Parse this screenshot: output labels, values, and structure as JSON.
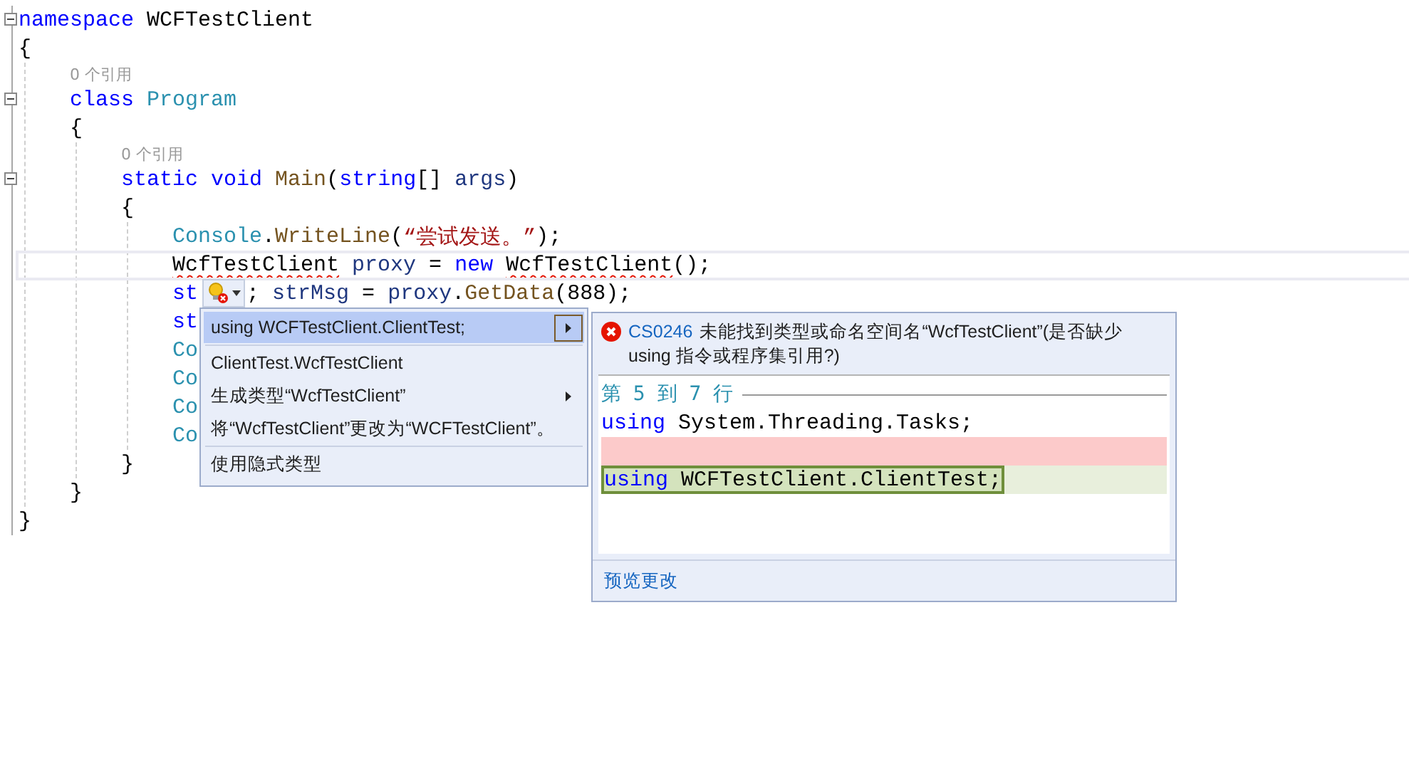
{
  "editor": {
    "blocks": [
      {
        "kind": "block",
        "expanded": true,
        "open": "{",
        "close": "}",
        "tokens": [
          {
            "text": "namespace",
            "kind": "keyword"
          },
          {
            "text": "WCFTestClient",
            "kind": "plain",
            "space_before": true
          }
        ],
        "children": [
          {
            "kind": "lens",
            "text": "0 个引用"
          },
          {
            "kind": "block",
            "expanded": true,
            "open": "{",
            "close": "}",
            "tokens": [
              {
                "text": "class",
                "kind": "keyword"
              },
              {
                "text": "Program",
                "kind": "type",
                "space_before": true
              }
            ],
            "children": [
              {
                "kind": "lens",
                "text": "0 个引用"
              },
              {
                "kind": "block",
                "expanded": true,
                "open": "{",
                "close": "}",
                "tokens": [
                  {
                    "text": "static",
                    "kind": "keyword"
                  },
                  {
                    "text": "void",
                    "kind": "keyword",
                    "space_before": true
                  },
                  {
                    "text": "Main",
                    "kind": "method",
                    "space_before": true
                  },
                  {
                    "text": "(",
                    "kind": "plain"
                  },
                  {
                    "text": "string",
                    "kind": "keyword"
                  },
                  {
                    "text": "[]",
                    "kind": "plain"
                  },
                  {
                    "text": "args",
                    "kind": "variable",
                    "space_before": true
                  },
                  {
                    "text": ")",
                    "kind": "plain"
                  }
                ],
                "children": [
                  {
                    "kind": "line",
                    "current": false,
                    "tokens": [
                      {
                        "text": "Console",
                        "kind": "type"
                      },
                      {
                        "text": ".",
                        "kind": "plain"
                      },
                      {
                        "text": "WriteLine",
                        "kind": "method"
                      },
                      {
                        "text": "(",
                        "kind": "plain"
                      },
                      {
                        "text": "“尝试发送。”",
                        "kind": "string"
                      },
                      {
                        "text": ");",
                        "kind": "plain"
                      }
                    ]
                  },
                  {
                    "kind": "line",
                    "current": true,
                    "tokens": [
                      {
                        "text": "WcfTestClient",
                        "kind": "error"
                      },
                      {
                        "text": "proxy",
                        "kind": "variable",
                        "space_before": true
                      },
                      {
                        "text": "=",
                        "kind": "plain",
                        "space_before": true
                      },
                      {
                        "text": "new",
                        "kind": "keyword",
                        "space_before": true
                      },
                      {
                        "text": "WcfTestClient",
                        "kind": "error",
                        "space_before": true
                      },
                      {
                        "text": "();",
                        "kind": "plain"
                      }
                    ]
                  },
                  {
                    "kind": "line",
                    "current": false,
                    "tokens": [
                      {
                        "text": "st",
                        "kind": "keyword"
                      },
                      {
                        "kind": "bulb"
                      },
                      {
                        "text": ";",
                        "kind": "plain"
                      },
                      {
                        "text": "strMsg",
                        "kind": "variable",
                        "space_before": true
                      },
                      {
                        "text": "=",
                        "kind": "plain",
                        "space_before": true
                      },
                      {
                        "text": "proxy",
                        "kind": "variable",
                        "space_before": true
                      },
                      {
                        "text": ".",
                        "kind": "plain"
                      },
                      {
                        "text": "GetData",
                        "kind": "method"
                      },
                      {
                        "text": "(888);",
                        "kind": "plain"
                      }
                    ]
                  },
                  {
                    "kind": "line",
                    "current": false,
                    "tokens": [
                      {
                        "text": "st",
                        "kind": "keyword"
                      }
                    ]
                  },
                  {
                    "kind": "line",
                    "current": false,
                    "tokens": [
                      {
                        "text": "Co",
                        "kind": "type"
                      }
                    ]
                  },
                  {
                    "kind": "line",
                    "current": false,
                    "tokens": [
                      {
                        "text": "Co",
                        "kind": "type"
                      }
                    ]
                  },
                  {
                    "kind": "line",
                    "current": false,
                    "tokens": [
                      {
                        "text": "Co",
                        "kind": "type"
                      }
                    ]
                  },
                  {
                    "kind": "line",
                    "current": false,
                    "tokens": [
                      {
                        "text": "Co",
                        "kind": "type"
                      }
                    ]
                  }
                ]
              }
            ]
          }
        ]
      }
    ]
  },
  "quick_actions": {
    "groups": [
      [
        {
          "label": "using WCFTestClient.ClientTest;",
          "selected": true,
          "submenu": true
        }
      ],
      [
        {
          "label": "ClientTest.WcfTestClient",
          "selected": false,
          "submenu": false
        },
        {
          "label": "生成类型“WcfTestClient”",
          "selected": false,
          "submenu": true
        },
        {
          "label": "将“WcfTestClient”更改为“WCFTestClient”。",
          "selected": false,
          "submenu": false
        }
      ],
      [
        {
          "label": "使用隐式类型",
          "selected": false,
          "submenu": false
        }
      ]
    ]
  },
  "preview": {
    "error_code": "CS0246",
    "message": "未能找到类型或命名空间名“WcfTestClient”(是否缺少 using 指令或程序集引用?)",
    "range": "第 5 到 7 行",
    "lines": [
      {
        "added": false,
        "removed": false,
        "tokens": [
          {
            "text": "using",
            "kind": "keyword"
          },
          {
            "text": "System.Threading.Tasks;",
            "kind": "plain",
            "space_before": true
          }
        ]
      },
      {
        "added": false,
        "removed": true
      },
      {
        "added": true,
        "removed": false,
        "tokens": [
          {
            "text": "using",
            "kind": "keyword"
          },
          {
            "text": "WCFTestClient.ClientTest;",
            "kind": "plain",
            "space_before": true
          }
        ]
      }
    ],
    "footer_link": "预览更改"
  }
}
